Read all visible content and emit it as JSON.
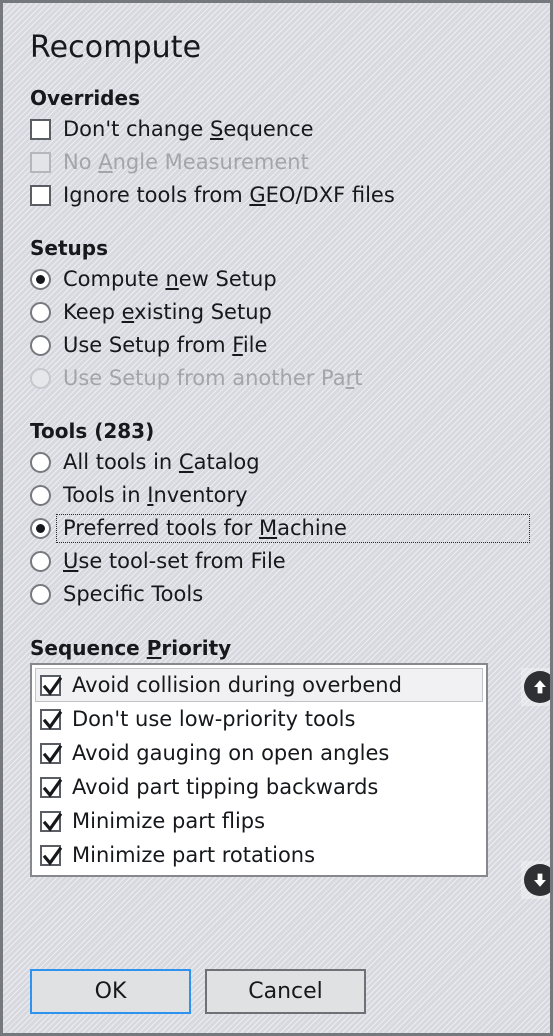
{
  "dialog": {
    "title": "Recompute",
    "accent_color": "#2f92ef",
    "background_color": "#d8d9e0",
    "text_color": "#16181c",
    "disabled_text_color": "#a3a5ab"
  },
  "overrides": {
    "heading": "Overrides",
    "items": [
      {
        "label_pre": "Don't change ",
        "accel": "S",
        "label_post": "equence",
        "checked": false,
        "enabled": true
      },
      {
        "label_pre": "No ",
        "accel": "A",
        "label_post": "ngle Measurement",
        "checked": false,
        "enabled": false
      },
      {
        "label_pre": "Ignore tools from ",
        "accel": "G",
        "label_post": "EO/DXF files",
        "checked": false,
        "enabled": true
      }
    ]
  },
  "setups": {
    "heading": "Setups",
    "items": [
      {
        "label_pre": "Compute ",
        "accel": "n",
        "label_post": "ew Setup",
        "selected": true,
        "enabled": true
      },
      {
        "label_pre": "Keep ",
        "accel": "e",
        "label_post": "xisting Setup",
        "selected": false,
        "enabled": true
      },
      {
        "label_pre": "Use Setup from ",
        "accel": "F",
        "label_post": "ile",
        "selected": false,
        "enabled": true
      },
      {
        "label_pre": "Use Setup from another Pa",
        "accel": "r",
        "label_post": "t",
        "selected": false,
        "enabled": false
      }
    ]
  },
  "tools": {
    "heading": "Tools (283)",
    "count": 283,
    "items": [
      {
        "label_pre": "All tools in ",
        "accel": "C",
        "label_post": "atalog",
        "selected": false,
        "enabled": true,
        "focused": false
      },
      {
        "label_pre": "Tools in ",
        "accel": "I",
        "label_post": "nventory",
        "selected": false,
        "enabled": true,
        "focused": false
      },
      {
        "label_pre": "Preferred tools for ",
        "accel": "M",
        "label_post": "achine",
        "selected": true,
        "enabled": true,
        "focused": true
      },
      {
        "label_pre": "",
        "accel": "U",
        "label_post": "se tool-set from File",
        "selected": false,
        "enabled": true,
        "focused": false
      },
      {
        "label_pre": "Specific Tools",
        "accel": "",
        "label_post": "",
        "selected": false,
        "enabled": true,
        "focused": false
      }
    ]
  },
  "sequence_priority": {
    "heading_pre": "Sequence ",
    "heading_accel": "P",
    "heading_post": "riority",
    "items": [
      {
        "label": "Avoid collision during overbend",
        "checked": true,
        "selected": true
      },
      {
        "label": "Don't use low-priority tools",
        "checked": true,
        "selected": false
      },
      {
        "label": "Avoid gauging on open angles",
        "checked": true,
        "selected": false
      },
      {
        "label": "Avoid part tipping backwards",
        "checked": true,
        "selected": false
      },
      {
        "label": "Minimize part flips",
        "checked": true,
        "selected": false
      },
      {
        "label": "Minimize part rotations",
        "checked": true,
        "selected": false
      }
    ],
    "move_up_icon": "arrow-up-icon",
    "move_down_icon": "arrow-down-icon"
  },
  "footer": {
    "ok_label": "OK",
    "cancel_label": "Cancel"
  }
}
